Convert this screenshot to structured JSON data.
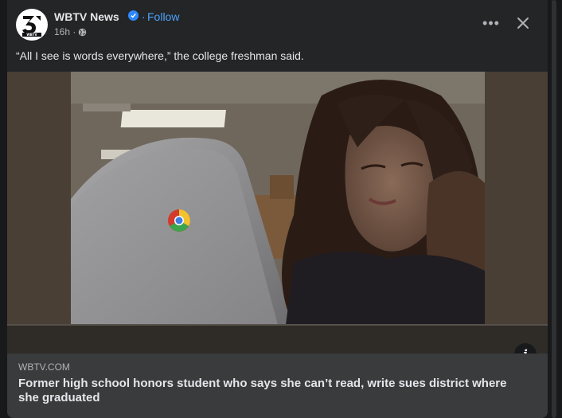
{
  "post": {
    "page_name": "WBTV News",
    "follow_label": "Follow",
    "time": "16h",
    "caption": "“All I see is words everywhere,” the college freshman said.",
    "avatar_logo_text": "3 WBTV"
  },
  "link_preview": {
    "domain": "WBTV.COM",
    "headline": "Former high school honors student who says she can’t read, write sues district where she graduated"
  },
  "icons": {
    "more": "more-options-icon",
    "close": "close-icon",
    "info": "info-icon",
    "globe": "globe-icon",
    "verified": "verified-badge-icon"
  },
  "colors": {
    "background": "#18191a",
    "card": "#242526",
    "preview": "#3a3b3c",
    "link_blue": "#4aa3ff",
    "verified_blue": "#2d88ff",
    "primary_text": "#e4e6eb",
    "secondary_text": "#b0b3b8"
  }
}
